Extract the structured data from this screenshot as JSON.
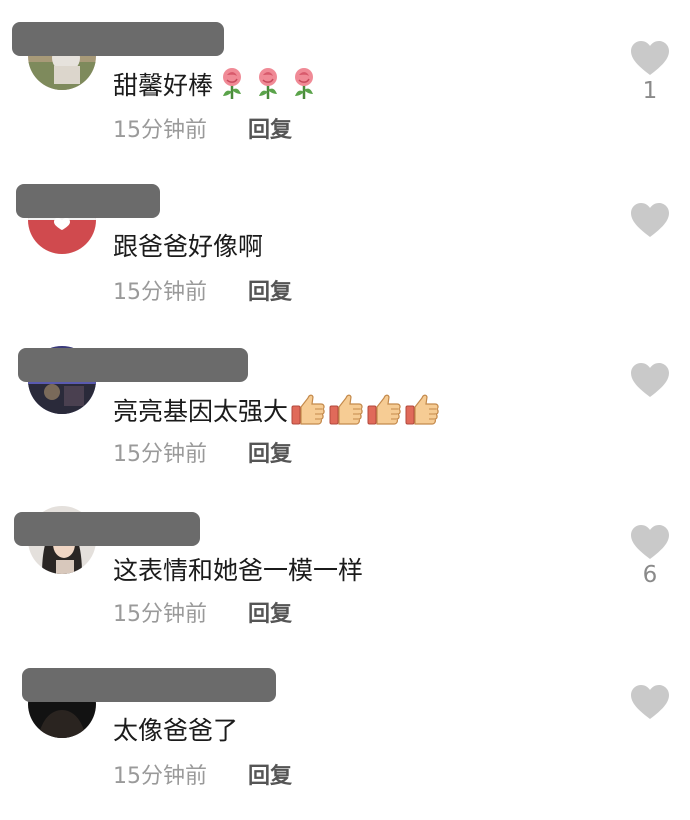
{
  "colors": {
    "text": "#1b1b1b",
    "meta": "#9a9a9a",
    "reply": "#555555",
    "heart": "#c9c9c9",
    "redaction": "#6b6b6b"
  },
  "comments": [
    {
      "text": "甜馨好棒",
      "emoji": [
        "rose",
        "rose",
        "rose"
      ],
      "time": "15分钟前",
      "reply": "回复",
      "likes": "1"
    },
    {
      "text": "跟爸爸好像啊",
      "emoji": [],
      "time": "15分钟前",
      "reply": "回复",
      "likes": ""
    },
    {
      "text": "亮亮基因太强大",
      "emoji": [
        "thumbs-up",
        "thumbs-up",
        "thumbs-up",
        "thumbs-up"
      ],
      "time": "15分钟前",
      "reply": "回复",
      "likes": ""
    },
    {
      "text": "这表情和她爸一模一样",
      "emoji": [],
      "time": "15分钟前",
      "reply": "回复",
      "likes": "6"
    },
    {
      "text": "太像爸爸了",
      "emoji": [],
      "time": "15分钟前",
      "reply": "回复",
      "likes": ""
    }
  ]
}
